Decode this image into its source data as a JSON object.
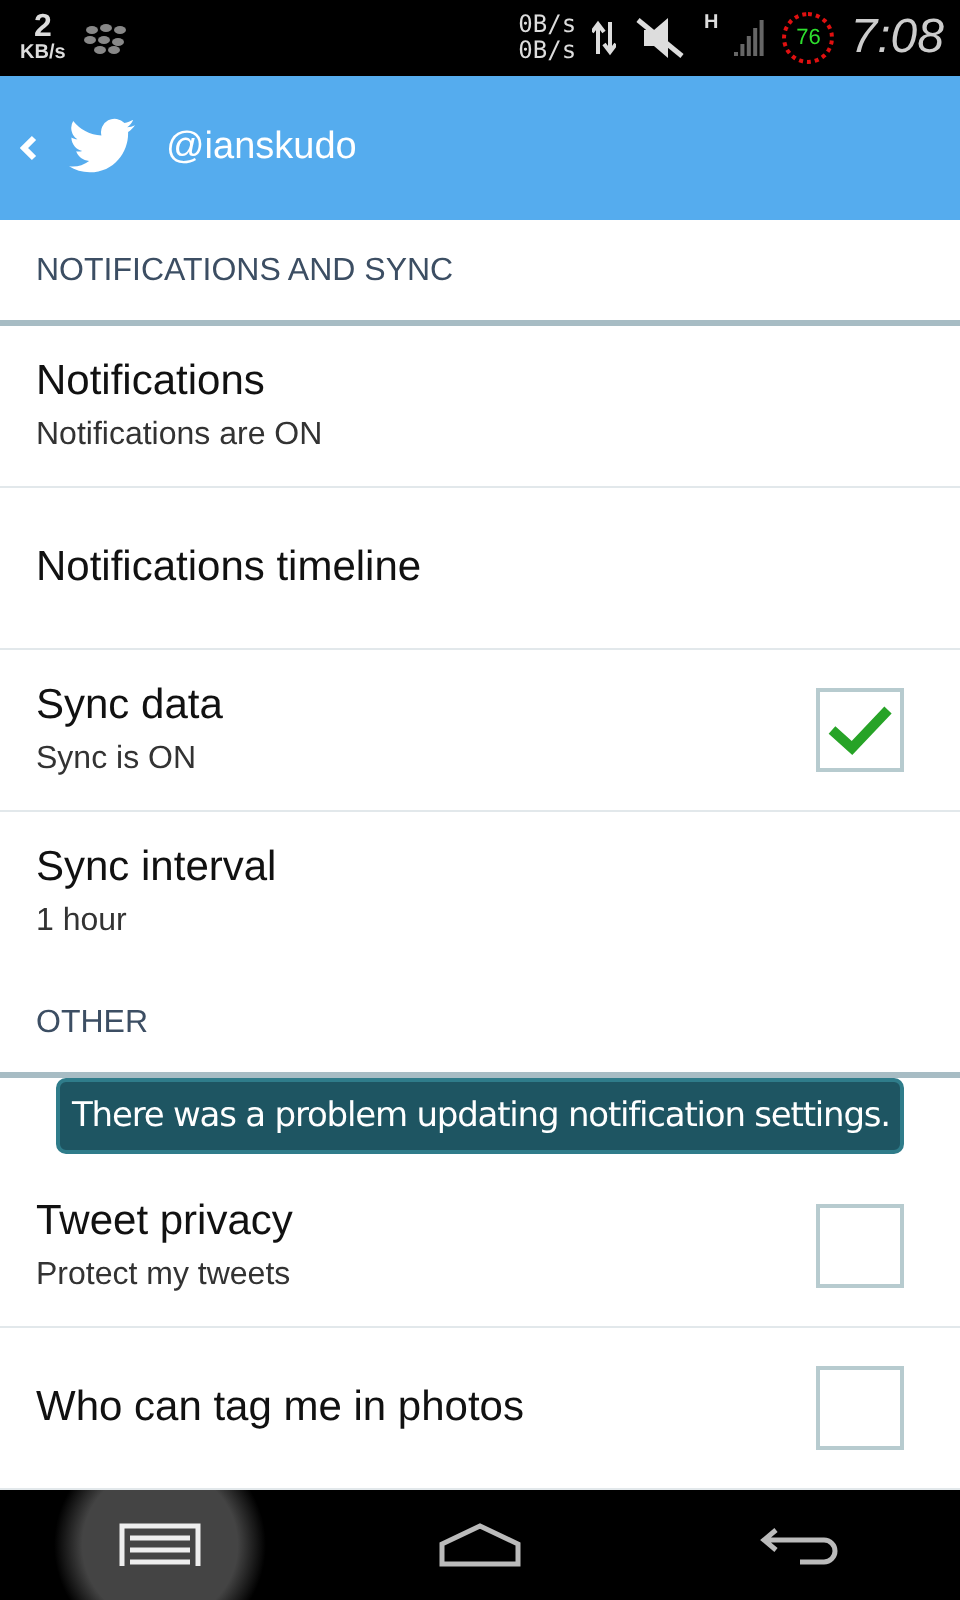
{
  "status_bar": {
    "speed": "2",
    "speed_unit": "KB/s",
    "upload": "0B/s",
    "download": "0B/s",
    "network": "H",
    "battery": "76",
    "time": "7:08"
  },
  "header": {
    "account": "@ianskudo"
  },
  "sections": [
    {
      "title": "NOTIFICATIONS AND SYNC",
      "items": [
        {
          "kind": "plain",
          "title": "Notifications",
          "subtitle": "Notifications are ON"
        },
        {
          "kind": "plain",
          "title": "Notifications timeline"
        },
        {
          "kind": "checkbox",
          "title": "Sync data",
          "subtitle": "Sync is ON",
          "checked": true
        },
        {
          "kind": "plain",
          "title": "Sync interval",
          "subtitle": "1 hour"
        }
      ]
    },
    {
      "title": "OTHER",
      "items": [
        {
          "kind": "checkbox",
          "title": "Tweet privacy",
          "subtitle": "Protect my tweets",
          "checked": false
        },
        {
          "kind": "checkbox",
          "title": "Who can tag me in photos",
          "checked": false
        }
      ]
    }
  ],
  "toast": {
    "message": "There was a problem updating notification settings."
  }
}
